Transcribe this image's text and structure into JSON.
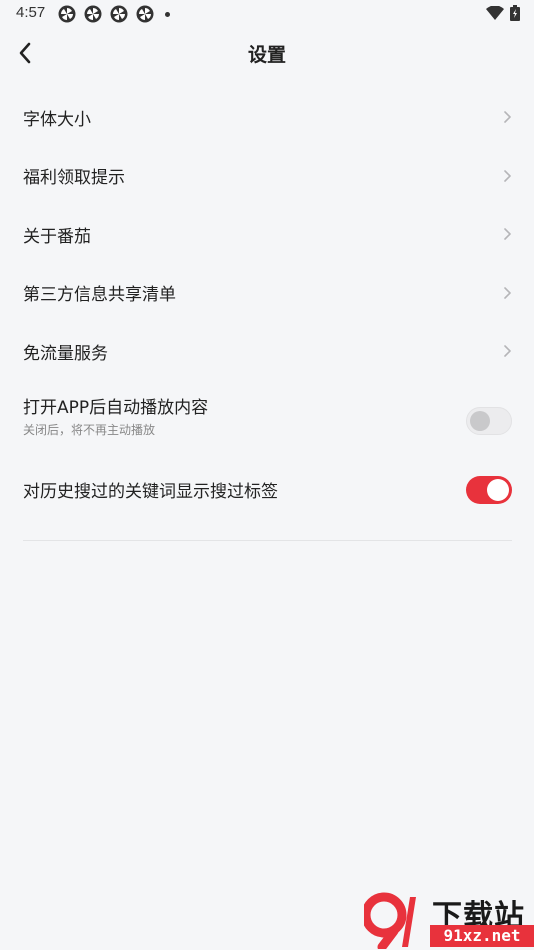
{
  "status_bar": {
    "time": "4:57",
    "app_icons": [
      "pinwheel-icon",
      "pinwheel-icon",
      "pinwheel-icon",
      "pinwheel-icon"
    ],
    "right_icons": [
      "wifi-icon",
      "battery-icon"
    ]
  },
  "header": {
    "title": "设置",
    "back_icon": "chevron-left-icon"
  },
  "settings": {
    "items": [
      {
        "label": "字体大小"
      },
      {
        "label": "福利领取提示"
      },
      {
        "label": "关于番茄"
      },
      {
        "label": "第三方信息共享清单"
      },
      {
        "label": "免流量服务"
      }
    ],
    "autoplay": {
      "label": "打开APP后自动播放内容",
      "sublabel": "关闭后，将不再主动播放",
      "enabled": false
    },
    "search_tags": {
      "label": "对历史搜过的关键词显示搜过标签",
      "enabled": true
    }
  },
  "watermark": {
    "text_top": "下载站",
    "text_bottom": "91xz.net"
  },
  "colors": {
    "accent": "#e8323c",
    "background": "#f5f6f8",
    "text": "#222222",
    "subtext": "#888888"
  }
}
